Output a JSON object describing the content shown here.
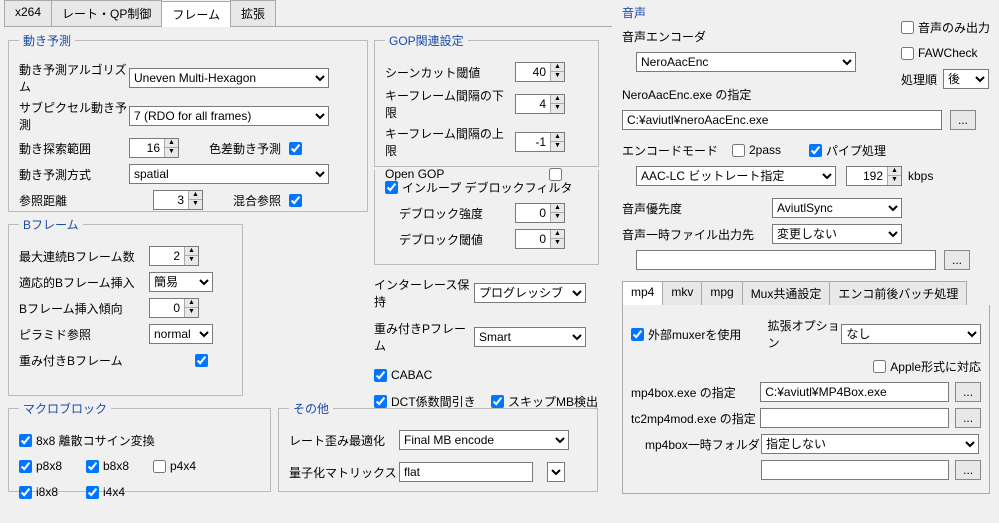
{
  "topTabs": {
    "x264": "x264",
    "rate": "レート・QP制御",
    "frame": "フレーム",
    "ext": "拡張"
  },
  "motion": {
    "legend": "動き予測",
    "algoLbl": "動き予測アルゴリズム",
    "algo": "Uneven Multi-Hexagon",
    "subpelLbl": "サブピクセル動き予測",
    "subpel": "7 (RDO for all frames)",
    "rangeLbl": "動き探索範囲",
    "range": "16",
    "chromaLbl": "色差動き予測",
    "methodLbl": "動き予測方式",
    "method": "spatial",
    "refLbl": "参照距離",
    "ref": "3",
    "mixedRefLbl": "混合参照"
  },
  "bframe": {
    "legend": "Bフレーム",
    "maxLbl": "最大連続Bフレーム数",
    "max": "2",
    "adaptLbl": "適応的Bフレーム挿入",
    "adapt": "簡易",
    "biasLbl": "Bフレーム挿入傾向",
    "bias": "0",
    "pyramidLbl": "ピラミド参照",
    "pyramid": "normal",
    "weightedLbl": "重み付きBフレーム"
  },
  "macro": {
    "legend": "マクロブロック",
    "dct8x8": "8x8 離散コサイン変換",
    "p8x8": "p8x8",
    "b8x8": "b8x8",
    "p4x4": "p4x4",
    "i8x8": "i8x8",
    "i4x4": "i4x4"
  },
  "gop": {
    "legend": "GOP関連設定",
    "sceneLbl": "シーンカット閾値",
    "scene": "40",
    "keyMinLbl": "キーフレーム間隔の下限",
    "keyMin": "4",
    "keyMaxLbl": "キーフレーム間隔の上限",
    "keyMax": "-1",
    "openGopLbl": "Open GOP"
  },
  "deblock": {
    "inloopLbl": "インループ デブロックフィルタ",
    "strengthLbl": "デブロック強度",
    "strength": "0",
    "threshLbl": "デブロック閾値",
    "thresh": "0"
  },
  "inter": {
    "interlaceLbl": "インターレース保持",
    "interlace": "プログレッシブ",
    "weightPLbl": "重み付きPフレーム",
    "weightP": "Smart",
    "cabacLbl": "CABAC",
    "dctLbl": "DCT係数間引き",
    "skipMbLbl": "スキップMB検出"
  },
  "other": {
    "legend": "その他",
    "rdoLbl": "レート歪み最適化",
    "rdo": "Final MB encode",
    "quantLbl": "量子化マトリックス",
    "quant": "flat"
  },
  "audio": {
    "title": "音声",
    "encoderLbl": "音声エンコーダ",
    "encoder": "NeroAacEnc",
    "audioOnlyLbl": "音声のみ出力",
    "fawLbl": "FAWCheck",
    "procOrderLbl": "処理順",
    "procOrder": "後",
    "neroPathLbl": "NeroAacEnc.exe の指定",
    "neroPath": "C:¥aviutl¥neroAacEnc.exe",
    "modeLbl": "エンコードモード",
    "twopassLbl": "2pass",
    "pipeLbl": "パイプ処理",
    "encMode": "AAC-LC ビットレート指定",
    "bitrate": "192",
    "kbps": "kbps",
    "priorityLbl": "音声優先度",
    "priority": "AviutlSync",
    "tempOutLbl": "音声一時ファイル出力先",
    "tempOut": "変更しない",
    "tempPath": ""
  },
  "muxTabs": {
    "mp4": "mp4",
    "mkv": "mkv",
    "mpg": "mpg",
    "mux": "Mux共通設定",
    "batch": "エンコ前後バッチ処理"
  },
  "mux": {
    "extMuxerLbl": "外部muxerを使用",
    "extOptLbl": "拡張オプション",
    "extOpt": "なし",
    "appleLbl": "Apple形式に対応",
    "mp4boxLbl": "mp4box.exe の指定",
    "mp4boxPath": "C:¥aviutl¥MP4Box.exe",
    "tc2Lbl": "tc2mp4mod.exe の指定",
    "tc2Path": "",
    "tempLbl": "mp4box一時フォルダ",
    "tempSel": "指定しない",
    "tempPath": ""
  },
  "ellipsis": "..."
}
